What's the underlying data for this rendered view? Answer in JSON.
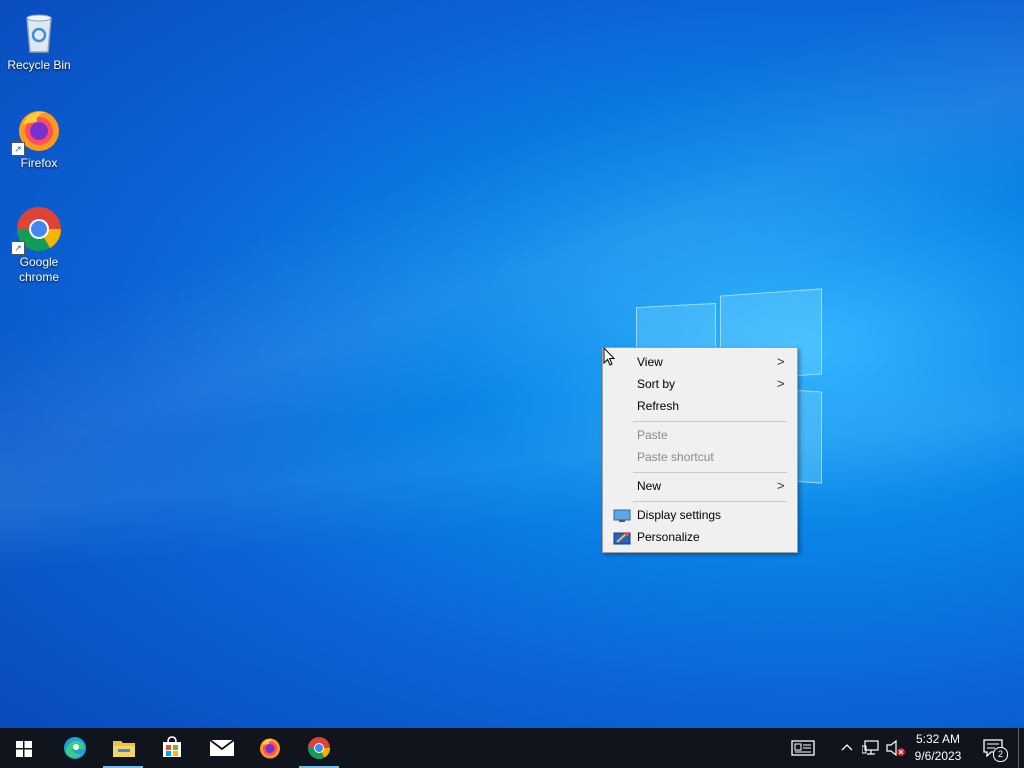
{
  "desktop": {
    "icons": [
      {
        "label": "Recycle Bin",
        "icon": "recycle-bin-icon"
      },
      {
        "label": "Firefox",
        "icon": "firefox-icon"
      },
      {
        "label": "Google chrome",
        "icon": "chrome-icon"
      }
    ]
  },
  "context_menu": {
    "items": [
      {
        "label": "View",
        "submenu": true,
        "enabled": true
      },
      {
        "label": "Sort by",
        "submenu": true,
        "enabled": true
      },
      {
        "label": "Refresh",
        "submenu": false,
        "enabled": true
      },
      {
        "label": "Paste",
        "submenu": false,
        "enabled": false
      },
      {
        "label": "Paste shortcut",
        "submenu": false,
        "enabled": false
      },
      {
        "label": "New",
        "submenu": true,
        "enabled": true
      },
      {
        "label": "Display settings",
        "submenu": false,
        "enabled": true,
        "icon": "display-icon"
      },
      {
        "label": "Personalize",
        "submenu": false,
        "enabled": true,
        "icon": "personalize-icon"
      }
    ],
    "arrow_glyph": ">"
  },
  "taskbar": {
    "apps": [
      {
        "name": "start",
        "icon": "windows-start-icon"
      },
      {
        "name": "edge",
        "icon": "edge-icon"
      },
      {
        "name": "file-explorer",
        "icon": "folder-icon",
        "active": true
      },
      {
        "name": "store",
        "icon": "store-icon"
      },
      {
        "name": "mail",
        "icon": "mail-icon"
      },
      {
        "name": "firefox",
        "icon": "firefox-icon"
      },
      {
        "name": "chrome",
        "icon": "chrome-icon",
        "active": true
      }
    ],
    "clock": {
      "time": "5:32 AM",
      "date": "9/6/2023"
    },
    "notification_count": "2"
  },
  "colors": {
    "taskbar": "#10141c",
    "menu_bg": "#f0f0f0",
    "accent": "#76b9ed"
  }
}
